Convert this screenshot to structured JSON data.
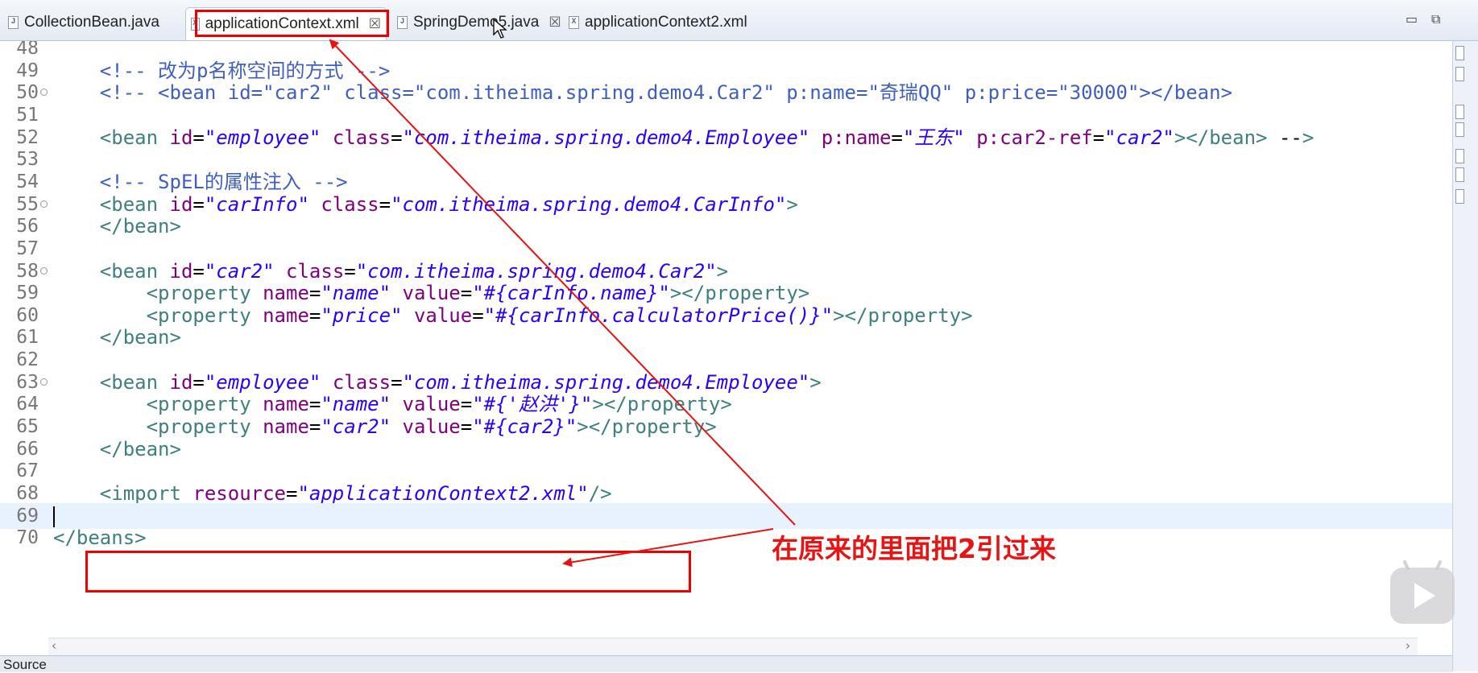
{
  "tabs": [
    {
      "label": "CollectionBean.java",
      "icon": "java-file-icon",
      "active": false,
      "closable": false
    },
    {
      "label": "applicationContext.xml",
      "icon": "xml-file-icon",
      "active": true,
      "closable": true
    },
    {
      "label": "SpringDemo5.java",
      "icon": "java-file-icon",
      "active": false,
      "closable": true
    },
    {
      "label": "applicationContext2.xml",
      "icon": "xml-file-icon",
      "active": false,
      "closable": false
    }
  ],
  "window_controls": {
    "minimize": "▭",
    "maximize": "⧉"
  },
  "close_glyph": "☒",
  "editor": {
    "current_line": "69",
    "lines": [
      {
        "n": "48",
        "t": ""
      },
      {
        "n": "49",
        "t": "    <!-- 改为p名称空间的方式 -->"
      },
      {
        "n": "50",
        "t": "    <!-- <bean id=\"car2\" class=\"com.itheima.spring.demo4.Car2\" p:name=\"奇瑞QQ\" p:price=\"30000\"></bean>"
      },
      {
        "n": "51",
        "t": ""
      },
      {
        "n": "52",
        "t": "    <bean id=\"employee\" class=\"com.itheima.spring.demo4.Employee\" p:name=\"王东\" p:car2-ref=\"car2\"></bean> -->"
      },
      {
        "n": "53",
        "t": ""
      },
      {
        "n": "54",
        "t": "    <!-- SpEL的属性注入 -->"
      },
      {
        "n": "55",
        "t": "    <bean id=\"carInfo\" class=\"com.itheima.spring.demo4.CarInfo\">"
      },
      {
        "n": "56",
        "t": "    </bean>"
      },
      {
        "n": "57",
        "t": ""
      },
      {
        "n": "58",
        "t": "    <bean id=\"car2\" class=\"com.itheima.spring.demo4.Car2\">"
      },
      {
        "n": "59",
        "t": "        <property name=\"name\" value=\"#{carInfo.name}\"></property>"
      },
      {
        "n": "60",
        "t": "        <property name=\"price\" value=\"#{carInfo.calculatorPrice()}\"></property>"
      },
      {
        "n": "61",
        "t": "    </bean>"
      },
      {
        "n": "62",
        "t": ""
      },
      {
        "n": "63",
        "t": "    <bean id=\"employee\" class=\"com.itheima.spring.demo4.Employee\">"
      },
      {
        "n": "64",
        "t": "        <property name=\"name\" value=\"#{'赵洪'}\"></property>"
      },
      {
        "n": "65",
        "t": "        <property name=\"car2\" value=\"#{car2}\"></property>"
      },
      {
        "n": "66",
        "t": "    </bean>"
      },
      {
        "n": "67",
        "t": ""
      },
      {
        "n": "68",
        "t": "    <import resource=\"applicationContext2.xml\"/>"
      },
      {
        "n": "69",
        "t": ""
      },
      {
        "n": "70",
        "t": "</beans>"
      }
    ],
    "fold_lines": [
      "50",
      "55",
      "58",
      "63"
    ]
  },
  "bottom_tab": "Source",
  "annotation_text": "在原来的里面把2引过来",
  "colors": {
    "comment": "#3f5fbf",
    "tag": "#3f7f7f",
    "attribute": "#7f007f",
    "string": "#2a00ff",
    "annotation_red": "#e81414"
  }
}
